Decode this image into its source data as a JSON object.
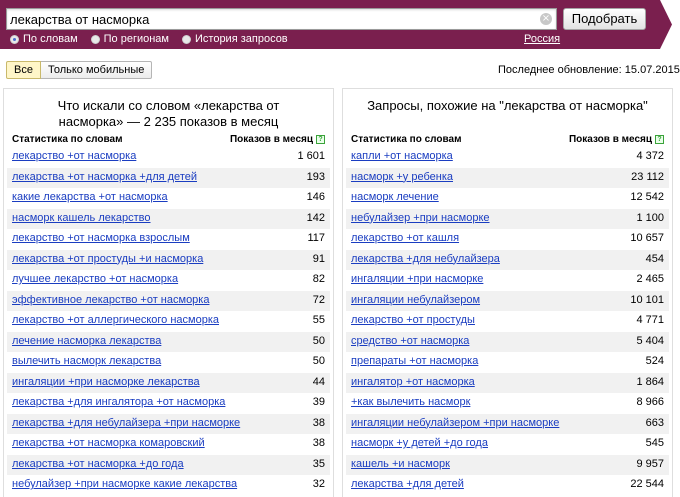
{
  "search": {
    "query": "лекарства от насморка",
    "clear_glyph": "×",
    "submit_label": "Подобрать",
    "modes": [
      {
        "label": "По словам",
        "checked": true
      },
      {
        "label": "По регионам",
        "checked": false
      },
      {
        "label": "История запросов",
        "checked": false
      }
    ],
    "region": "Россия"
  },
  "filters": {
    "all_label": "Все",
    "mobile_label": "Только мобильные"
  },
  "last_update": "Последнее обновление: 15.07.2015",
  "colors": {
    "header_band": "#7a1f4e",
    "link": "#1a3dc1",
    "row_alt": "#f1f1f1"
  },
  "left_panel": {
    "title_line1": "Что искали со словом «лекарства от",
    "title_line2": "насморка» — 2 235 показов в месяц",
    "col_words": "Статистика по словам",
    "col_shows": "Показов в месяц",
    "help_glyph": "?",
    "rows": [
      {
        "phrase": "лекарство +от насморка",
        "count": "1 601"
      },
      {
        "phrase": "лекарства +от насморка +для детей",
        "count": "193"
      },
      {
        "phrase": "какие лекарства +от насморка",
        "count": "146"
      },
      {
        "phrase": "насморк кашель лекарство",
        "count": "142"
      },
      {
        "phrase": "лекарство +от насморка взрослым",
        "count": "117"
      },
      {
        "phrase": "лекарства +от простуды +и насморка",
        "count": "91"
      },
      {
        "phrase": "лучшее лекарство +от насморка",
        "count": "82"
      },
      {
        "phrase": "эффективное лекарство +от насморка",
        "count": "72"
      },
      {
        "phrase": "лекарство +от аллергического насморка",
        "count": "55"
      },
      {
        "phrase": "лечение насморка лекарства",
        "count": "50"
      },
      {
        "phrase": "вылечить насморк лекарства",
        "count": "50"
      },
      {
        "phrase": "ингаляции +при насморке лекарства",
        "count": "44"
      },
      {
        "phrase": "лекарства +для ингалятора +от насморка",
        "count": "39"
      },
      {
        "phrase": "лекарства +для небулайзера +при насморке",
        "count": "38"
      },
      {
        "phrase": "лекарства +от насморка комаровский",
        "count": "38"
      },
      {
        "phrase": "лекарства +от насморка +до года",
        "count": "35"
      },
      {
        "phrase": "небулайзер +при насморке какие лекарства",
        "count": "32"
      }
    ]
  },
  "right_panel": {
    "title": "Запросы, похожие на \"лекарства от насморка\"",
    "col_words": "Статистика по словам",
    "col_shows": "Показов в месяц",
    "help_glyph": "?",
    "rows": [
      {
        "phrase": "капли +от насморка",
        "count": "4 372"
      },
      {
        "phrase": "насморк +у ребенка",
        "count": "23 112"
      },
      {
        "phrase": "насморк лечение",
        "count": "12 542"
      },
      {
        "phrase": "небулайзер +при насморке",
        "count": "1 100"
      },
      {
        "phrase": "лекарство +от кашля",
        "count": "10 657"
      },
      {
        "phrase": "лекарства +для небулайзера",
        "count": "454"
      },
      {
        "phrase": "ингаляции +при насморке",
        "count": "2 465"
      },
      {
        "phrase": "ингаляции небулайзером",
        "count": "10 101"
      },
      {
        "phrase": "лекарство +от простуды",
        "count": "4 771"
      },
      {
        "phrase": "средство +от насморка",
        "count": "5 404"
      },
      {
        "phrase": "препараты +от насморка",
        "count": "524"
      },
      {
        "phrase": "ингалятор +от насморка",
        "count": "1 864"
      },
      {
        "phrase": "+как вылечить насморк",
        "count": "8 966"
      },
      {
        "phrase": "ингаляции небулайзером +при насморке",
        "count": "663"
      },
      {
        "phrase": "насморк +у детей +до года",
        "count": "545"
      },
      {
        "phrase": "кашель +и насморк",
        "count": "9 957"
      },
      {
        "phrase": "лекарства +для детей",
        "count": "22 544"
      }
    ]
  }
}
